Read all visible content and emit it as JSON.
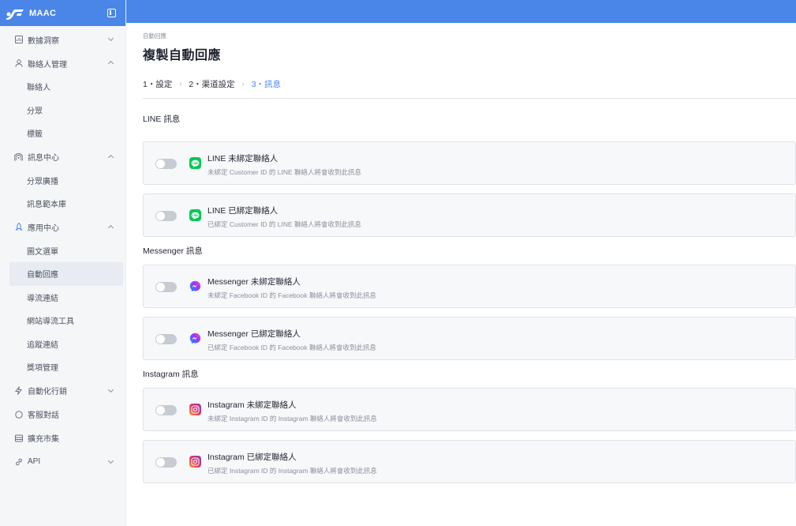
{
  "brand": {
    "name": "MAAC"
  },
  "sidebar": {
    "groups": [
      {
        "label": "數據洞察",
        "icon": "chart-icon",
        "expanded": false,
        "items": []
      },
      {
        "label": "聯絡人管理",
        "icon": "user-icon",
        "expanded": true,
        "items": [
          "聯絡人",
          "分眾",
          "標籤"
        ]
      },
      {
        "label": "訊息中心",
        "icon": "broadcast-icon",
        "expanded": true,
        "items": [
          "分眾廣播",
          "訊息範本庫"
        ]
      },
      {
        "label": "應用中心",
        "icon": "rocket-icon",
        "expanded": true,
        "items": [
          "圖文選單",
          "自動回應",
          "導流連結",
          "網站導流工具",
          "追蹤連結",
          "獎項管理"
        ]
      },
      {
        "label": "自動化行銷",
        "icon": "bolt-icon",
        "expanded": false,
        "items": []
      },
      {
        "label": "客服對話",
        "icon": "chat-icon",
        "expanded": null,
        "items": []
      },
      {
        "label": "擴充市集",
        "icon": "store-icon",
        "expanded": null,
        "items": []
      },
      {
        "label": "API",
        "icon": "link-icon",
        "expanded": false,
        "items": []
      }
    ],
    "active_item": "自動回應"
  },
  "page": {
    "breadcrumb": "自動回應",
    "title": "複製自動回應"
  },
  "steps": [
    {
      "label": "1・設定",
      "active": false
    },
    {
      "label": "2・渠道設定",
      "active": false
    },
    {
      "label": "3・訊息",
      "active": true
    }
  ],
  "sections": [
    {
      "title": "LINE 訊息",
      "platform": "line",
      "cards": [
        {
          "title": "LINE 未綁定聯絡人",
          "desc": "未綁定 Customer ID 的 LINE 聯絡人將會收到此訊息",
          "enabled": false
        },
        {
          "title": "LINE 已綁定聯絡人",
          "desc": "已綁定 Customer ID 的 LINE 聯絡人將會收到此訊息",
          "enabled": false
        }
      ]
    },
    {
      "title": "Messenger 訊息",
      "platform": "messenger",
      "cards": [
        {
          "title": "Messenger 未綁定聯絡人",
          "desc": "未綁定 Facebook ID 的 Facebook 聯絡人將會收到此訊息",
          "enabled": false
        },
        {
          "title": "Messenger 已綁定聯絡人",
          "desc": "已綁定 Facebook ID 的 Facebook 聯絡人將會收到此訊息",
          "enabled": false
        }
      ]
    },
    {
      "title": "Instagram 訊息",
      "platform": "instagram",
      "cards": [
        {
          "title": "Instagram 未綁定聯絡人",
          "desc": "未綁定 Instagram ID 的 Instagram 聯絡人將會收到此訊息",
          "enabled": false
        },
        {
          "title": "Instagram 已綁定聯絡人",
          "desc": "已綁定 Instagram ID 的 Instagram 聯絡人將會收到此訊息",
          "enabled": false
        }
      ]
    }
  ],
  "colors": {
    "primary": "#4a86e8",
    "line": "#06c755",
    "messenger": "#7b5cff",
    "instagram": "#e1306c"
  }
}
